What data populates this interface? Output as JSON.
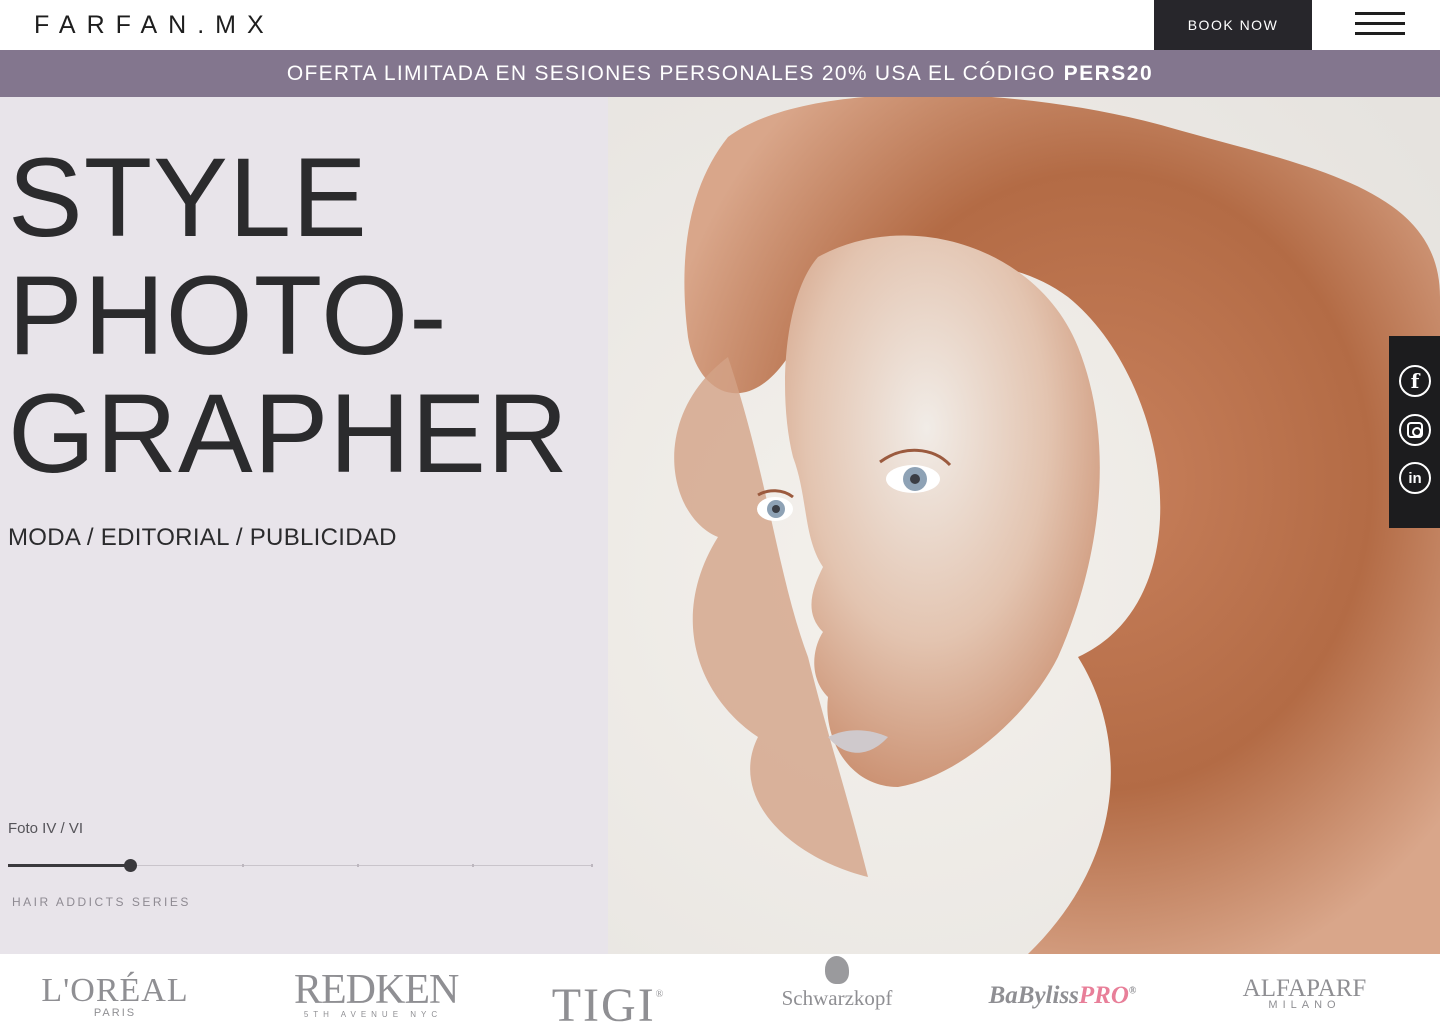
{
  "header": {
    "logo": "FARFAN.MX",
    "book_label": "BOOK NOW",
    "menu_icon": "hamburger-menu-icon"
  },
  "promo": {
    "text": "OFERTA LIMITADA EN SESIONES PERSONALES 20% USA EL CÓDIGO",
    "code": "PERS20"
  },
  "hero": {
    "title_lines": [
      "STYLE",
      "PHOTO-",
      "GRAPHER"
    ],
    "subtitle": "MODA / EDITORIAL / PUBLICIDAD",
    "photo_counter": "Foto IV / VI",
    "slider_current": 4,
    "slider_total": 6,
    "series": "HAIR ADDICTS SERIES"
  },
  "social": [
    {
      "name": "facebook-icon",
      "glyph": "f"
    },
    {
      "name": "instagram-icon",
      "glyph": ""
    },
    {
      "name": "linkedin-icon",
      "glyph": "in"
    }
  ],
  "brands": {
    "loreal": {
      "main": "L'ORÉAL",
      "sub": "PARIS"
    },
    "redken": {
      "main": "REDKEN",
      "sub": "5TH AVENUE NYC"
    },
    "tigi": {
      "main": "TIGI",
      "mark": "®"
    },
    "schwarzkopf": {
      "main": "Schwarzkopf"
    },
    "babyliss": {
      "main": "BaByliss",
      "pro": "PRO",
      "mark": "®"
    },
    "alfaparf": {
      "main": "ALFAPARF",
      "sub": "MILANO"
    }
  },
  "colors": {
    "promo_bg": "#83768e",
    "panel_bg": "#e8e4ea",
    "dark": "#27262b",
    "accent_pink": "#e87f99"
  }
}
